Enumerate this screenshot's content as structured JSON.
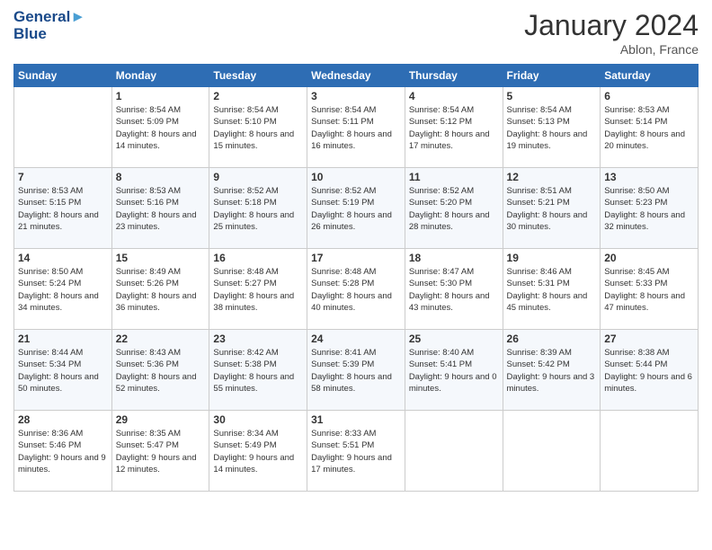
{
  "header": {
    "logo_line1": "General",
    "logo_line2": "Blue",
    "month_title": "January 2024",
    "subtitle": "Ablon, France"
  },
  "days_of_week": [
    "Sunday",
    "Monday",
    "Tuesday",
    "Wednesday",
    "Thursday",
    "Friday",
    "Saturday"
  ],
  "weeks": [
    [
      {
        "day": "",
        "sunrise": "",
        "sunset": "",
        "daylight": ""
      },
      {
        "day": "1",
        "sunrise": "Sunrise: 8:54 AM",
        "sunset": "Sunset: 5:09 PM",
        "daylight": "Daylight: 8 hours and 14 minutes."
      },
      {
        "day": "2",
        "sunrise": "Sunrise: 8:54 AM",
        "sunset": "Sunset: 5:10 PM",
        "daylight": "Daylight: 8 hours and 15 minutes."
      },
      {
        "day": "3",
        "sunrise": "Sunrise: 8:54 AM",
        "sunset": "Sunset: 5:11 PM",
        "daylight": "Daylight: 8 hours and 16 minutes."
      },
      {
        "day": "4",
        "sunrise": "Sunrise: 8:54 AM",
        "sunset": "Sunset: 5:12 PM",
        "daylight": "Daylight: 8 hours and 17 minutes."
      },
      {
        "day": "5",
        "sunrise": "Sunrise: 8:54 AM",
        "sunset": "Sunset: 5:13 PM",
        "daylight": "Daylight: 8 hours and 19 minutes."
      },
      {
        "day": "6",
        "sunrise": "Sunrise: 8:53 AM",
        "sunset": "Sunset: 5:14 PM",
        "daylight": "Daylight: 8 hours and 20 minutes."
      }
    ],
    [
      {
        "day": "7",
        "sunrise": "Sunrise: 8:53 AM",
        "sunset": "Sunset: 5:15 PM",
        "daylight": "Daylight: 8 hours and 21 minutes."
      },
      {
        "day": "8",
        "sunrise": "Sunrise: 8:53 AM",
        "sunset": "Sunset: 5:16 PM",
        "daylight": "Daylight: 8 hours and 23 minutes."
      },
      {
        "day": "9",
        "sunrise": "Sunrise: 8:52 AM",
        "sunset": "Sunset: 5:18 PM",
        "daylight": "Daylight: 8 hours and 25 minutes."
      },
      {
        "day": "10",
        "sunrise": "Sunrise: 8:52 AM",
        "sunset": "Sunset: 5:19 PM",
        "daylight": "Daylight: 8 hours and 26 minutes."
      },
      {
        "day": "11",
        "sunrise": "Sunrise: 8:52 AM",
        "sunset": "Sunset: 5:20 PM",
        "daylight": "Daylight: 8 hours and 28 minutes."
      },
      {
        "day": "12",
        "sunrise": "Sunrise: 8:51 AM",
        "sunset": "Sunset: 5:21 PM",
        "daylight": "Daylight: 8 hours and 30 minutes."
      },
      {
        "day": "13",
        "sunrise": "Sunrise: 8:50 AM",
        "sunset": "Sunset: 5:23 PM",
        "daylight": "Daylight: 8 hours and 32 minutes."
      }
    ],
    [
      {
        "day": "14",
        "sunrise": "Sunrise: 8:50 AM",
        "sunset": "Sunset: 5:24 PM",
        "daylight": "Daylight: 8 hours and 34 minutes."
      },
      {
        "day": "15",
        "sunrise": "Sunrise: 8:49 AM",
        "sunset": "Sunset: 5:26 PM",
        "daylight": "Daylight: 8 hours and 36 minutes."
      },
      {
        "day": "16",
        "sunrise": "Sunrise: 8:48 AM",
        "sunset": "Sunset: 5:27 PM",
        "daylight": "Daylight: 8 hours and 38 minutes."
      },
      {
        "day": "17",
        "sunrise": "Sunrise: 8:48 AM",
        "sunset": "Sunset: 5:28 PM",
        "daylight": "Daylight: 8 hours and 40 minutes."
      },
      {
        "day": "18",
        "sunrise": "Sunrise: 8:47 AM",
        "sunset": "Sunset: 5:30 PM",
        "daylight": "Daylight: 8 hours and 43 minutes."
      },
      {
        "day": "19",
        "sunrise": "Sunrise: 8:46 AM",
        "sunset": "Sunset: 5:31 PM",
        "daylight": "Daylight: 8 hours and 45 minutes."
      },
      {
        "day": "20",
        "sunrise": "Sunrise: 8:45 AM",
        "sunset": "Sunset: 5:33 PM",
        "daylight": "Daylight: 8 hours and 47 minutes."
      }
    ],
    [
      {
        "day": "21",
        "sunrise": "Sunrise: 8:44 AM",
        "sunset": "Sunset: 5:34 PM",
        "daylight": "Daylight: 8 hours and 50 minutes."
      },
      {
        "day": "22",
        "sunrise": "Sunrise: 8:43 AM",
        "sunset": "Sunset: 5:36 PM",
        "daylight": "Daylight: 8 hours and 52 minutes."
      },
      {
        "day": "23",
        "sunrise": "Sunrise: 8:42 AM",
        "sunset": "Sunset: 5:38 PM",
        "daylight": "Daylight: 8 hours and 55 minutes."
      },
      {
        "day": "24",
        "sunrise": "Sunrise: 8:41 AM",
        "sunset": "Sunset: 5:39 PM",
        "daylight": "Daylight: 8 hours and 58 minutes."
      },
      {
        "day": "25",
        "sunrise": "Sunrise: 8:40 AM",
        "sunset": "Sunset: 5:41 PM",
        "daylight": "Daylight: 9 hours and 0 minutes."
      },
      {
        "day": "26",
        "sunrise": "Sunrise: 8:39 AM",
        "sunset": "Sunset: 5:42 PM",
        "daylight": "Daylight: 9 hours and 3 minutes."
      },
      {
        "day": "27",
        "sunrise": "Sunrise: 8:38 AM",
        "sunset": "Sunset: 5:44 PM",
        "daylight": "Daylight: 9 hours and 6 minutes."
      }
    ],
    [
      {
        "day": "28",
        "sunrise": "Sunrise: 8:36 AM",
        "sunset": "Sunset: 5:46 PM",
        "daylight": "Daylight: 9 hours and 9 minutes."
      },
      {
        "day": "29",
        "sunrise": "Sunrise: 8:35 AM",
        "sunset": "Sunset: 5:47 PM",
        "daylight": "Daylight: 9 hours and 12 minutes."
      },
      {
        "day": "30",
        "sunrise": "Sunrise: 8:34 AM",
        "sunset": "Sunset: 5:49 PM",
        "daylight": "Daylight: 9 hours and 14 minutes."
      },
      {
        "day": "31",
        "sunrise": "Sunrise: 8:33 AM",
        "sunset": "Sunset: 5:51 PM",
        "daylight": "Daylight: 9 hours and 17 minutes."
      },
      {
        "day": "",
        "sunrise": "",
        "sunset": "",
        "daylight": ""
      },
      {
        "day": "",
        "sunrise": "",
        "sunset": "",
        "daylight": ""
      },
      {
        "day": "",
        "sunrise": "",
        "sunset": "",
        "daylight": ""
      }
    ]
  ]
}
